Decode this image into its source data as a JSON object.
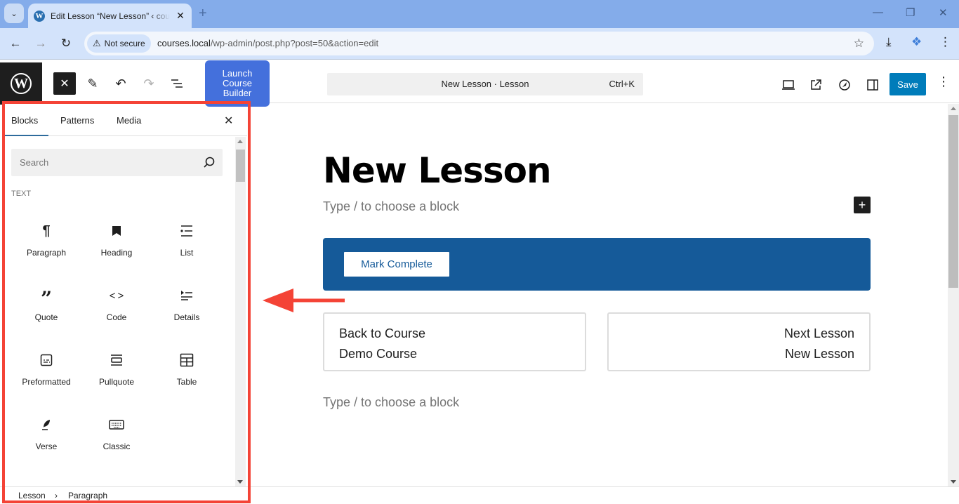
{
  "browser": {
    "tab": {
      "title": "Edit Lesson “New Lesson” ‹ courses — WordPress",
      "favicon": "wordpress-icon"
    },
    "new_tab_icon": "+",
    "window_controls": [
      "minimize",
      "restore",
      "close"
    ],
    "security_label": "Not secure",
    "url_host": "courses.local",
    "url_path": "/wp-admin/post.php?post=50&action=edit"
  },
  "editor_header": {
    "launch_button": "Launch Course Builder",
    "command_title": "New Lesson · Lesson",
    "command_shortcut": "Ctrl+K",
    "save_label": "Save",
    "colors": {
      "save": "#007cba",
      "launch": "#4470dc"
    }
  },
  "inserter": {
    "tabs": [
      {
        "label": "Blocks",
        "active": true
      },
      {
        "label": "Patterns",
        "active": false
      },
      {
        "label": "Media",
        "active": false
      }
    ],
    "search_placeholder": "Search",
    "category": "TEXT",
    "blocks": [
      {
        "label": "Paragraph",
        "icon": "paragraph-icon"
      },
      {
        "label": "Heading",
        "icon": "heading-icon"
      },
      {
        "label": "List",
        "icon": "list-icon"
      },
      {
        "label": "Quote",
        "icon": "quote-icon"
      },
      {
        "label": "Code",
        "icon": "code-icon"
      },
      {
        "label": "Details",
        "icon": "details-icon"
      },
      {
        "label": "Preformatted",
        "icon": "preformatted-icon"
      },
      {
        "label": "Pullquote",
        "icon": "pullquote-icon"
      },
      {
        "label": "Table",
        "icon": "table-icon"
      },
      {
        "label": "Verse",
        "icon": "verse-icon"
      },
      {
        "label": "Classic",
        "icon": "classic-icon"
      }
    ]
  },
  "breadcrumb": [
    "Lesson",
    "Paragraph"
  ],
  "canvas": {
    "title": "New Lesson",
    "placeholder": "Type / to choose a block",
    "mark_complete": "Mark Complete",
    "banner_color": "#155a99",
    "back_card": {
      "line1": "Back to Course",
      "line2": "Demo Course"
    },
    "next_card": {
      "line1": "Next Lesson",
      "line2": "New Lesson"
    }
  },
  "annotation": {
    "color": "#f44336"
  }
}
